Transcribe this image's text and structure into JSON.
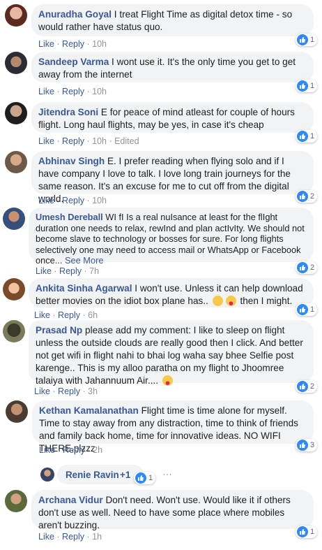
{
  "colors": {
    "link": "#385898",
    "bubble": "#f2f3f5",
    "like_blue": "#2e89ff"
  },
  "comments": [
    {
      "author": "Anuradha Goyal",
      "text": "I treat Flight Time as digital detox time - so would rather have status quo.",
      "like": "Like",
      "reply": "Reply",
      "time": "10h",
      "likes": "1"
    },
    {
      "author": "Sandeep Varma",
      "text": "I wont use it. It's the only time you get to get away from the internet",
      "like": "Like",
      "reply": "Reply",
      "time": "10h",
      "likes": "1"
    },
    {
      "author": "Jitendra Soni",
      "text": "E for peace of mind atleast for couple of hours flight. Long haul flights, may be yes, in case it's cheap",
      "like": "Like",
      "reply": "Reply",
      "time": "10h",
      "edited": "Edited",
      "likes": "1"
    },
    {
      "author": "Abhinav Singh",
      "text": "E. I prefer reading when flying solo and if I have company I love to talk. I love long train journeys for the same reason. It's an excuse for me to cut off from the digital world.",
      "like": "Like",
      "reply": "Reply",
      "time": "10h",
      "likes": "2"
    },
    {
      "author": "Umesh Dereball",
      "text": "WI fI Is a real nuIsance at least for the flIght duratIon one needs to relax, rewInd and plan actIvIty. We should not become slave to technology or bosses for sure. For long flights selectively one may need to access mail or WhatsApp or Facebook once...",
      "see_more": "See More",
      "like": "Like",
      "reply": "Reply",
      "time": "7h",
      "likes": "2"
    },
    {
      "author": "Ankita Sinha Agarwal",
      "text": "I won't use. Unless it can help download better movies on the idiot box plane has..",
      "text_after": "then I might.",
      "like": "Like",
      "reply": "Reply",
      "time": "6h",
      "likes": "1"
    },
    {
      "author": "Prasad Np",
      "text": "please add my comment: I like to sleep on flight unless the outside clouds are really good then I click. And better not get wifi in flight nahi to bhai log waha say bhee Selfie post karenge.. This is my alloo paratha on my flight to Jhoomree talaiya with Jahannuum Air....",
      "like": "Like",
      "reply": "Reply",
      "time": "3h",
      "likes": "2"
    },
    {
      "author": "Kethan Kamalanathan",
      "text": "Flight time is time alone for myself. Time to stay away from any distraction, time to think of friends and family back home, time for innovative ideas. NO WIFI THERE.plzzz",
      "like": "Like",
      "reply": "Reply",
      "time": "2h",
      "likes": "3"
    },
    {
      "author": "Archana Vidur",
      "text": "Don't need. Won't use. Would like it if others don't use as well. Need to have some place where mobiles aren't buzzing.",
      "like": "Like",
      "reply": "Reply",
      "time": "1h",
      "likes": "1"
    }
  ],
  "reply_preview": {
    "author": "Renie Ravin",
    "suffix": "+1",
    "likes": "1",
    "menu": "···"
  }
}
